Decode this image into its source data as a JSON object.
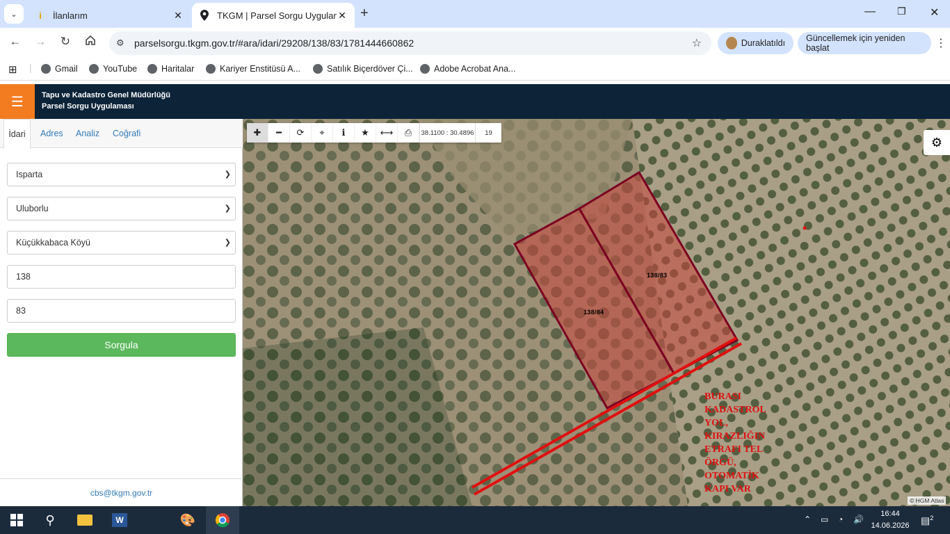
{
  "browser": {
    "tabs": [
      {
        "title": "İlanlarım",
        "icon": "ilan-favicon",
        "active": false
      },
      {
        "title": "TKGM | Parsel Sorgu Uygulaması",
        "icon": "location-pin-icon",
        "active": true
      }
    ],
    "new_tab_label": "+",
    "url": "parselsorgu.tkgm.gov.tr/#ara/idari/29208/138/83/1781444660862",
    "profile_label": "Duraklatıldı",
    "update_label": "Güncellemek için yeniden başlat",
    "bookmarks": [
      "Gmail",
      "YouTube",
      "Haritalar",
      "Kariyer Enstitüsü A...",
      "Satılık Biçerdöver Çi...",
      "Adobe Acrobat Ana..."
    ]
  },
  "app": {
    "title_line1": "Tapu ve Kadastro Genel Müdürlüğü",
    "title_line2": "Parsel Sorgu Uygulaması",
    "accent_color": "#f47c20",
    "header_color": "#0c2338"
  },
  "panel": {
    "tabs": [
      "İdari",
      "Adres",
      "Analiz",
      "Coğrafi"
    ],
    "active_tab": "İdari",
    "province": "Isparta",
    "district": "Uluborlu",
    "village": "Küçükkabaca Köyü",
    "ada": "138",
    "parsel": "83",
    "submit_label": "Sorgula",
    "contact": "cbs@tkgm.gov.tr"
  },
  "map": {
    "coordinates": "38.1100 : 30.4896",
    "zoom_level": "19",
    "parcels": [
      "138/84",
      "138/83"
    ],
    "annotation_lines": [
      "BURASI",
      "KADASTROL",
      "YOL,",
      "KIRAZLIĞIN",
      "ETRAFI TEL",
      "ÖRGÜ,",
      "OTOMATİK",
      "KAPI VAR"
    ],
    "attribution": "© HGM Atlas",
    "parcel_color": "#7a0020",
    "annotation_color": "#e01010"
  },
  "taskbar": {
    "time": "16:44",
    "date": "14.06.2026",
    "notification_count": "2"
  }
}
